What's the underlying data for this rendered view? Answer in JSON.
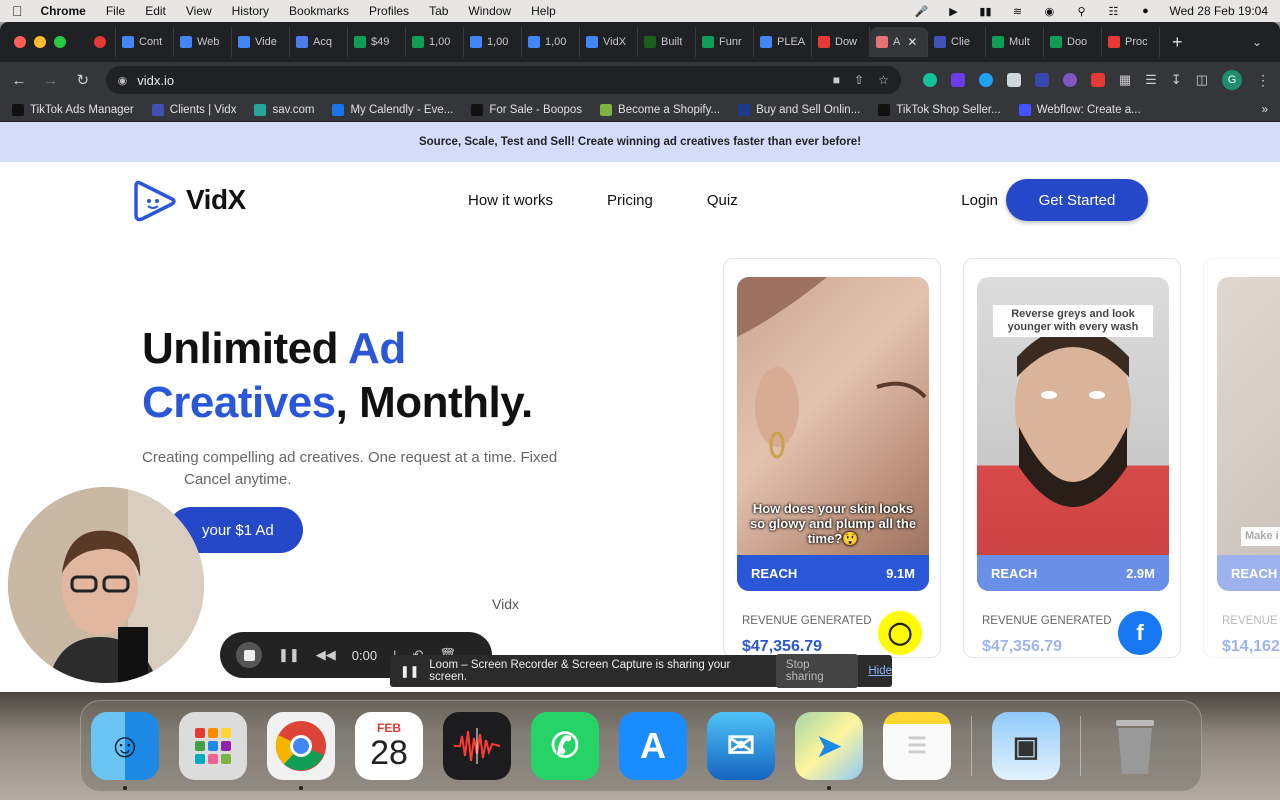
{
  "menubar": {
    "app": "Chrome",
    "items": [
      "File",
      "Edit",
      "View",
      "History",
      "Bookmarks",
      "Profiles",
      "Tab",
      "Window",
      "Help"
    ],
    "datetime": "Wed 28 Feb  19:04"
  },
  "tabs": [
    {
      "title": "Cont",
      "color": "#4285f4"
    },
    {
      "title": "Web",
      "color": "#4285f4"
    },
    {
      "title": "Vide",
      "color": "#4285f4"
    },
    {
      "title": "Acq",
      "color": "#4b7bec"
    },
    {
      "title": "$49",
      "color": "#0f9d58"
    },
    {
      "title": "1,00",
      "color": "#0f9d58"
    },
    {
      "title": "1,00",
      "color": "#4285f4"
    },
    {
      "title": "1,00",
      "color": "#4285f4"
    },
    {
      "title": "VidX",
      "color": "#4285f4"
    },
    {
      "title": "Built",
      "color": "#1b5e20"
    },
    {
      "title": "Funr",
      "color": "#0f9d58"
    },
    {
      "title": "PLEA",
      "color": "#4285f4"
    },
    {
      "title": "Dow",
      "color": "#e53935"
    },
    {
      "title": "A",
      "color": "#e57373",
      "active": true
    },
    {
      "title": "Clie",
      "color": "#3f51b5"
    },
    {
      "title": "Mult",
      "color": "#0f9d58"
    },
    {
      "title": "Doo",
      "color": "#0f9d58"
    },
    {
      "title": "Proc",
      "color": "#e53935"
    }
  ],
  "browser": {
    "url": "vidx.io",
    "profile_initial": "G"
  },
  "bookmarks": [
    {
      "label": "TikTok Ads Manager",
      "color": "#111"
    },
    {
      "label": "Clients | Vidx",
      "color": "#3f51b5"
    },
    {
      "label": "sav.com",
      "color": "#26a69a"
    },
    {
      "label": "My Calendly - Eve...",
      "color": "#1a73e8"
    },
    {
      "label": "For Sale - Boopos",
      "color": "#111"
    },
    {
      "label": "Become a Shopify...",
      "color": "#7cb342"
    },
    {
      "label": "Buy and Sell Onlin...",
      "color": "#1e3a8a"
    },
    {
      "label": "TikTok Shop Seller...",
      "color": "#111"
    },
    {
      "label": "Webflow: Create a...",
      "color": "#4353ff"
    }
  ],
  "site": {
    "announcement": "Source, Scale, Test and Sell! Create winning ad creatives faster than ever before!",
    "logo_text": "VidX",
    "nav": [
      "How it works",
      "Pricing",
      "Quiz"
    ],
    "login": "Login",
    "cta": "Get Started",
    "hero_line1_a": "Unlimited ",
    "hero_line1_b": "Ad",
    "hero_line2_a": "Creatives",
    "hero_line2_b": ", Monthly.",
    "hero_sub_1": "Creating compelling ad creatives. One request at a time. Fixed",
    "hero_sub_2": "Cancel anytime.",
    "hero_btn": "your $1 Ad",
    "social_proof": "Vidx"
  },
  "cards": [
    {
      "caption": "How does your skin looks so glowy and plump all the time?😲",
      "reach_label": "REACH",
      "reach_value": "9.1M",
      "revenue_label": "REVENUE GENERATED",
      "revenue_value": "$47,356.79",
      "platform": "snapchat-icon"
    },
    {
      "top_caption": "Reverse greys and look younger with every wash",
      "reach_label": "REACH",
      "reach_value": "2.9M",
      "revenue_label": "REVENUE GENERATED",
      "revenue_value": "$47,356.79",
      "platform": "facebook-icon"
    },
    {
      "top_caption": "Make i",
      "reach_label": "REACH",
      "revenue_label": "REVENUE G",
      "revenue_value": "$14,162"
    }
  ],
  "loom": {
    "timer": "0:00",
    "share_text": "Loom – Screen Recorder & Screen Capture is sharing your screen.",
    "stop_label": "Stop sharing",
    "hide_label": "Hide"
  },
  "dock": {
    "calendar_month": "FEB",
    "calendar_day": "28"
  }
}
